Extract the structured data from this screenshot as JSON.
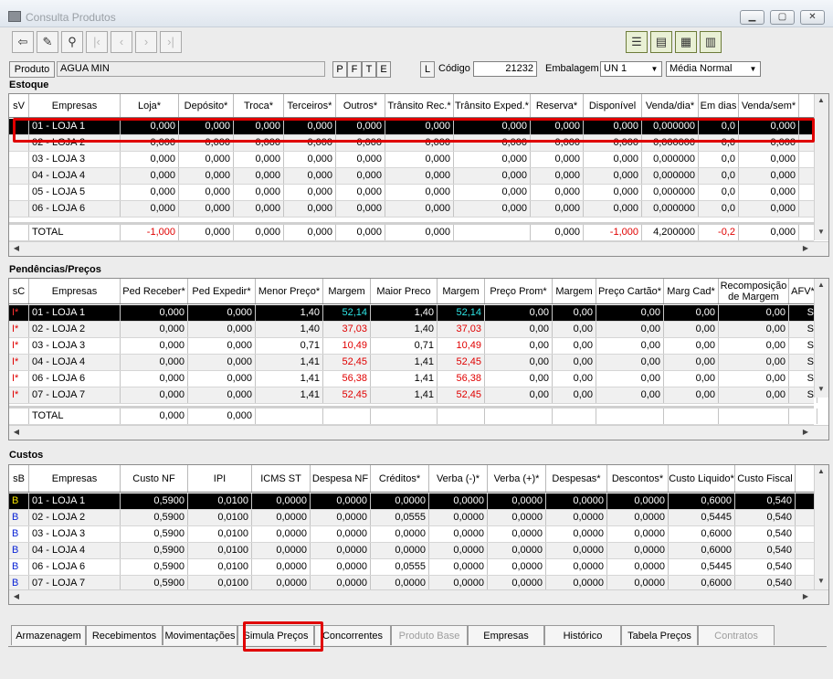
{
  "window": {
    "title": "Consulta Produtos"
  },
  "product": {
    "produto_label": "Produto",
    "produto_value": "AGUA MIN",
    "pfte": [
      "P",
      "F",
      "T",
      "E"
    ],
    "l_label": "L",
    "codigo_label": "Código",
    "codigo_value": "21232",
    "embalagem_label": "Embalagem",
    "embalagem_value": "UN  1",
    "media_value": "Média Normal"
  },
  "estoque": {
    "title": "Estoque",
    "headers": [
      "sV",
      "Empresas",
      "Loja*",
      "Depósito*",
      "Troca*",
      "Terceiros*",
      "Outros*",
      "Trânsito Rec.*",
      "Trânsito Exped.*",
      "Reserva*",
      "Disponível",
      "Venda/dia*",
      "Em dias",
      "Venda/sem*"
    ],
    "rows": [
      [
        "",
        "01 - LOJA    1",
        "0,000",
        "0,000",
        "0,000",
        "0,000",
        "0,000",
        "0,000",
        "0,000",
        "0,000",
        "0,000",
        "0,000000",
        "0,0",
        "0,000"
      ],
      [
        "",
        "02 - LOJA    2",
        "0,000",
        "0,000",
        "0,000",
        "0,000",
        "0,000",
        "0,000",
        "0,000",
        "0,000",
        "0,000",
        "0,000000",
        "0,0",
        "0,000"
      ],
      [
        "",
        "03 - LOJA    3",
        "0,000",
        "0,000",
        "0,000",
        "0,000",
        "0,000",
        "0,000",
        "0,000",
        "0,000",
        "0,000",
        "0,000000",
        "0,0",
        "0,000"
      ],
      [
        "",
        "04 - LOJA    4",
        "0,000",
        "0,000",
        "0,000",
        "0,000",
        "0,000",
        "0,000",
        "0,000",
        "0,000",
        "0,000",
        "0,000000",
        "0,0",
        "0,000"
      ],
      [
        "",
        "05 - LOJA    5",
        "0,000",
        "0,000",
        "0,000",
        "0,000",
        "0,000",
        "0,000",
        "0,000",
        "0,000",
        "0,000",
        "0,000000",
        "0,0",
        "0,000"
      ],
      [
        "",
        "06 - LOJA    6",
        "0,000",
        "0,000",
        "0,000",
        "0,000",
        "0,000",
        "0,000",
        "0,000",
        "0,000",
        "0,000",
        "0,000000",
        "0,0",
        "0,000"
      ]
    ],
    "total": [
      "",
      "TOTAL",
      "-1,000",
      "0,000",
      "0,000",
      "0,000",
      "0,000",
      "0,000",
      "",
      "0,000",
      "-1,000",
      "4,200000",
      "-0,2",
      "0,000"
    ]
  },
  "pendencias": {
    "title": "Pendências/Preços",
    "headers": [
      "sC",
      "Empresas",
      "Ped Receber*",
      "Ped Expedir*",
      "Menor Preço*",
      "Margem",
      "Maior Preco",
      "Margem",
      "Preço Prom*",
      "Margem",
      "Preço Cartão*",
      "Marg Cad*",
      "Recomposição de Margem",
      "AFV*"
    ],
    "rows": [
      [
        "I*",
        "01 - LOJA    1",
        "0,000",
        "0,000",
        "1,40",
        "52,14",
        "1,40",
        "52,14",
        "0,00",
        "0,00",
        "0,00",
        "0,00",
        "0,00",
        "S"
      ],
      [
        "I*",
        "02 - LOJA    2",
        "0,000",
        "0,000",
        "1,40",
        "37,03",
        "1,40",
        "37,03",
        "0,00",
        "0,00",
        "0,00",
        "0,00",
        "0,00",
        "S"
      ],
      [
        "I*",
        "03 - LOJA    3",
        "0,000",
        "0,000",
        "0,71",
        "10,49",
        "0,71",
        "10,49",
        "0,00",
        "0,00",
        "0,00",
        "0,00",
        "0,00",
        "S"
      ],
      [
        "I*",
        "04 - LOJA    4",
        "0,000",
        "0,000",
        "1,41",
        "52,45",
        "1,41",
        "52,45",
        "0,00",
        "0,00",
        "0,00",
        "0,00",
        "0,00",
        "S"
      ],
      [
        "I*",
        "06 - LOJA    6",
        "0,000",
        "0,000",
        "1,41",
        "56,38",
        "1,41",
        "56,38",
        "0,00",
        "0,00",
        "0,00",
        "0,00",
        "0,00",
        "S"
      ],
      [
        "I*",
        "07 - LOJA    7",
        "0,000",
        "0,000",
        "1,41",
        "52,45",
        "1,41",
        "52,45",
        "0,00",
        "0,00",
        "0,00",
        "0,00",
        "0,00",
        "S"
      ]
    ],
    "total": [
      "",
      "TOTAL",
      "0,000",
      "0,000",
      "",
      "",
      "",
      "",
      "",
      "",
      "",
      "",
      "",
      ""
    ]
  },
  "custos": {
    "title": "Custos",
    "headers": [
      "sB",
      "Empresas",
      "Custo NF",
      "IPI",
      "ICMS ST",
      "Despesa NF",
      "Créditos*",
      "Verba (-)*",
      "Verba (+)*",
      "Despesas*",
      "Descontos*",
      "Custo Liquido*",
      "Custo Fiscal"
    ],
    "rows": [
      [
        "B",
        "01 - LOJA    1",
        "0,5900",
        "0,0100",
        "0,0000",
        "0,0000",
        "0,0000",
        "0,0000",
        "0,0000",
        "0,0000",
        "0,0000",
        "0,6000",
        "0,540"
      ],
      [
        "B",
        "02 - LOJA    2",
        "0,5900",
        "0,0100",
        "0,0000",
        "0,0000",
        "0,0555",
        "0,0000",
        "0,0000",
        "0,0000",
        "0,0000",
        "0,5445",
        "0,540"
      ],
      [
        "B",
        "03 - LOJA    3",
        "0,5900",
        "0,0100",
        "0,0000",
        "0,0000",
        "0,0000",
        "0,0000",
        "0,0000",
        "0,0000",
        "0,0000",
        "0,6000",
        "0,540"
      ],
      [
        "B",
        "04 - LOJA    4",
        "0,5900",
        "0,0100",
        "0,0000",
        "0,0000",
        "0,0000",
        "0,0000",
        "0,0000",
        "0,0000",
        "0,0000",
        "0,6000",
        "0,540"
      ],
      [
        "B",
        "06 - LOJA    6",
        "0,5900",
        "0,0100",
        "0,0000",
        "0,0000",
        "0,0555",
        "0,0000",
        "0,0000",
        "0,0000",
        "0,0000",
        "0,5445",
        "0,540"
      ],
      [
        "B",
        "07 - LOJA    7",
        "0,5900",
        "0,0100",
        "0,0000",
        "0,0000",
        "0,0000",
        "0,0000",
        "0,0000",
        "0,0000",
        "0,0000",
        "0,6000",
        "0,540"
      ]
    ]
  },
  "tabs": [
    {
      "label": "Armazenagem",
      "enabled": true
    },
    {
      "label": "Recebimentos",
      "enabled": true
    },
    {
      "label": "Movimentações",
      "enabled": true
    },
    {
      "label": "Simula Preços",
      "enabled": true
    },
    {
      "label": "Concorrentes",
      "enabled": true
    },
    {
      "label": "Produto Base",
      "enabled": false
    },
    {
      "label": "Empresas",
      "enabled": true
    },
    {
      "label": "Histórico",
      "enabled": true
    },
    {
      "label": "Tabela Preços",
      "enabled": true
    },
    {
      "label": "Contratos",
      "enabled": false
    }
  ],
  "colors": {
    "selected_row": "#000000",
    "negative": "#e00000",
    "margin_selected": "#2ee6e6",
    "b_flag": "#0b25d6",
    "highlight": "#e00000"
  }
}
